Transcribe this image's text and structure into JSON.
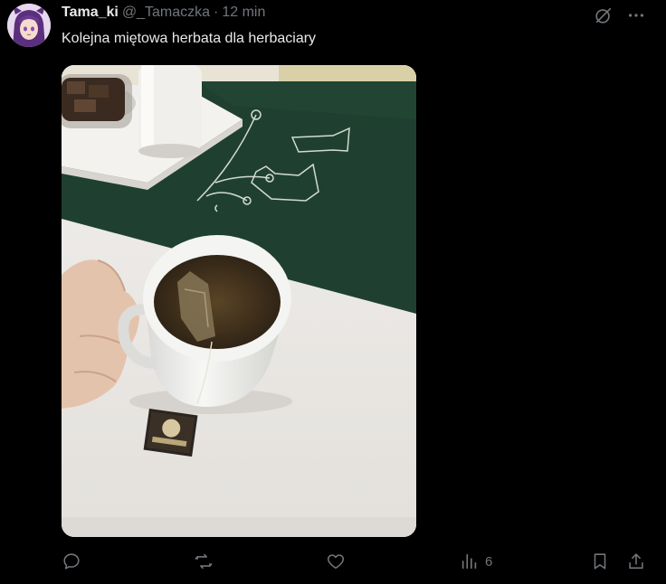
{
  "post": {
    "display_name": "Tama_ki",
    "handle": "@_Tamaczka",
    "separator": "·",
    "time": "12 min",
    "text": "Kolejna miętowa herbata dla herbaciary",
    "avatar": "anime-character-avatar"
  },
  "top_icons": [
    "grok-icon",
    "more-icon"
  ],
  "actions": {
    "reply": {
      "icon": "reply-icon"
    },
    "repost": {
      "icon": "repost-icon"
    },
    "like": {
      "icon": "heart-icon"
    },
    "views": {
      "icon": "views-icon",
      "count": "6"
    },
    "bookmark": {
      "icon": "bookmark-icon"
    },
    "share": {
      "icon": "share-icon"
    }
  },
  "colors": {
    "background": "#000000",
    "primary_text": "#e7e9ea",
    "secondary_text": "#71767b"
  }
}
